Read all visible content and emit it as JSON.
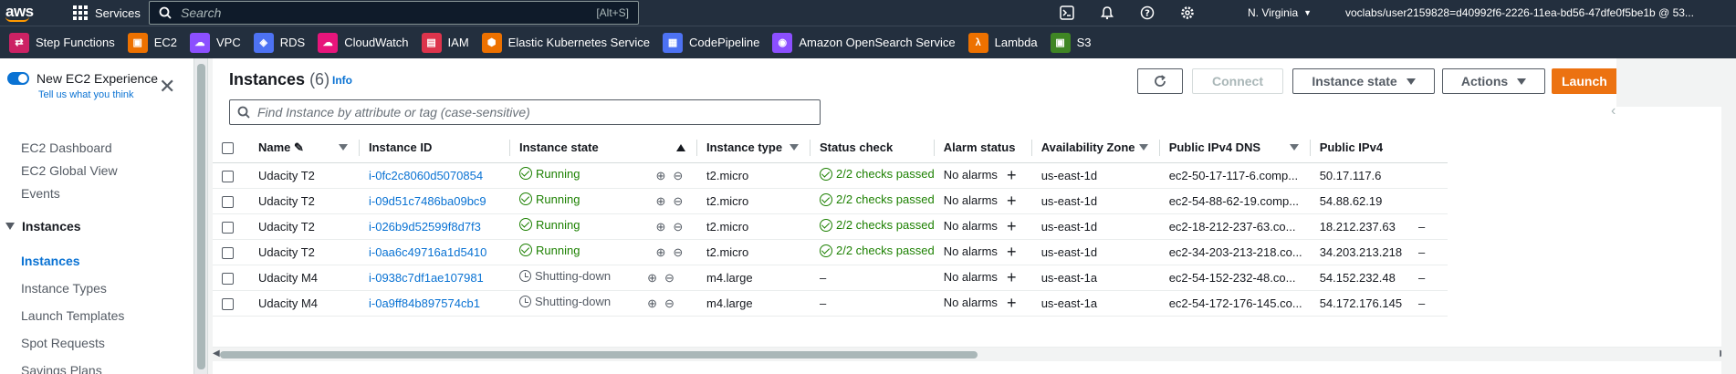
{
  "topbar": {
    "logo": "aws",
    "services_label": "Services",
    "search_placeholder": "Search",
    "search_shortcut": "[Alt+S]",
    "region": "N. Virginia",
    "account": "voclabs/user2159828=d40992f6-2226-11ea-bd56-47dfe0f5be1b @ 53..."
  },
  "favorites": [
    {
      "label": "Step Functions",
      "color": "#cc2264",
      "icon": "step-functions-icon",
      "glyph": "⇄"
    },
    {
      "label": "EC2",
      "color": "#ed7100",
      "icon": "ec2-icon",
      "glyph": "▣"
    },
    {
      "label": "VPC",
      "color": "#8c4fff",
      "icon": "vpc-icon",
      "glyph": "☁"
    },
    {
      "label": "RDS",
      "color": "#4d72f3",
      "icon": "rds-icon",
      "glyph": "◈"
    },
    {
      "label": "CloudWatch",
      "color": "#e7157b",
      "icon": "cloudwatch-icon",
      "glyph": "☁"
    },
    {
      "label": "IAM",
      "color": "#dd344c",
      "icon": "iam-icon",
      "glyph": "▤"
    },
    {
      "label": "Elastic Kubernetes Service",
      "color": "#ed7100",
      "icon": "eks-icon",
      "glyph": "⬢"
    },
    {
      "label": "CodePipeline",
      "color": "#4d72f3",
      "icon": "codepipeline-icon",
      "glyph": "▦"
    },
    {
      "label": "Amazon OpenSearch Service",
      "color": "#8c4fff",
      "icon": "opensearch-icon",
      "glyph": "◉"
    },
    {
      "label": "Lambda",
      "color": "#ed7100",
      "icon": "lambda-icon",
      "glyph": "λ"
    },
    {
      "label": "S3",
      "color": "#3f8624",
      "icon": "s3-icon",
      "glyph": "▣"
    }
  ],
  "sidebar": {
    "toggle_label": "New EC2 Experience",
    "toggle_sub": "Tell us what you think",
    "items": [
      "EC2 Dashboard",
      "EC2 Global View",
      "Events"
    ],
    "section": "Instances",
    "section_items": [
      "Instances",
      "Instance Types",
      "Launch Templates",
      "Spot Requests",
      "Savings Plans"
    ]
  },
  "main": {
    "title": "Instances",
    "count": "(6)",
    "info": "Info",
    "buttons": {
      "connect": "Connect",
      "instance_state": "Instance state",
      "actions": "Actions",
      "launch": "Launch"
    },
    "filter_placeholder": "Find Instance by attribute or tag (case-sensitive)",
    "columns": [
      "Name",
      "Instance ID",
      "Instance state",
      "Instance type",
      "Status check",
      "Alarm status",
      "Availability Zone",
      "Public IPv4 DNS",
      "Public IPv4"
    ],
    "rows": [
      {
        "name": "Udacity T2",
        "id": "i-0fc2c8060d5070854",
        "state": "Running",
        "type": "t2.micro",
        "status": "2/2 checks passed",
        "alarm": "No alarms",
        "az": "us-east-1d",
        "dns": "ec2-50-17-117-6.comp...",
        "ip": "50.17.117.6",
        "extra": ""
      },
      {
        "name": "Udacity T2",
        "id": "i-09d51c7486ba09bc9",
        "state": "Running",
        "type": "t2.micro",
        "status": "2/2 checks passed",
        "alarm": "No alarms",
        "az": "us-east-1d",
        "dns": "ec2-54-88-62-19.comp...",
        "ip": "54.88.62.19",
        "extra": ""
      },
      {
        "name": "Udacity T2",
        "id": "i-026b9d52599f8d7f3",
        "state": "Running",
        "type": "t2.micro",
        "status": "2/2 checks passed",
        "alarm": "No alarms",
        "az": "us-east-1d",
        "dns": "ec2-18-212-237-63.co...",
        "ip": "18.212.237.63",
        "extra": "–"
      },
      {
        "name": "Udacity T2",
        "id": "i-0aa6c49716a1d5410",
        "state": "Running",
        "type": "t2.micro",
        "status": "2/2 checks passed",
        "alarm": "No alarms",
        "az": "us-east-1d",
        "dns": "ec2-34-203-213-218.co...",
        "ip": "34.203.213.218",
        "extra": "–"
      },
      {
        "name": "Udacity M4",
        "id": "i-0938c7df1ae107981",
        "state": "Shutting-down",
        "type": "m4.large",
        "status": "–",
        "alarm": "No alarms",
        "az": "us-east-1a",
        "dns": "ec2-54-152-232-48.co...",
        "ip": "54.152.232.48",
        "extra": "–"
      },
      {
        "name": "Udacity M4",
        "id": "i-0a9ff84b897574cb1",
        "state": "Shutting-down",
        "type": "m4.large",
        "status": "–",
        "alarm": "No alarms",
        "az": "us-east-1a",
        "dns": "ec2-54-172-176-145.co...",
        "ip": "54.172.176.145",
        "extra": "–"
      }
    ]
  }
}
